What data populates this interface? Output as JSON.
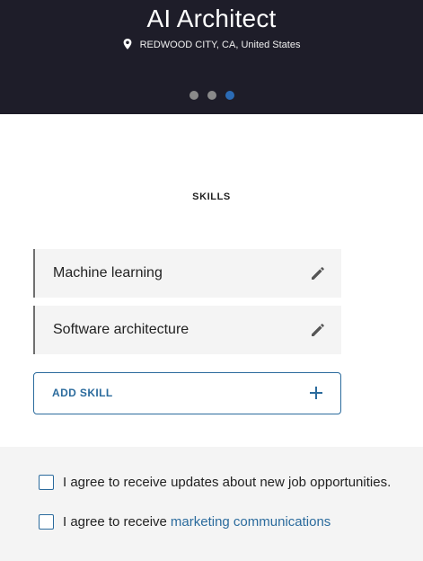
{
  "header": {
    "job_title": "AI Architect",
    "location": "REDWOOD CITY, CA, United States",
    "carousel": {
      "total": 3,
      "active_index": 3
    }
  },
  "skills": {
    "heading": "SKILLS",
    "items": [
      {
        "label": "Machine learning"
      },
      {
        "label": "Software architecture"
      }
    ],
    "add_label": "ADD SKILL"
  },
  "consent": {
    "job_updates": "I agree to receive updates about new job opportunities.",
    "marketing_prefix": "I agree to receive",
    "marketing_link": "marketing communications"
  },
  "colors": {
    "header_bg": "#1e1d29",
    "accent": "#2b6b9d",
    "active_dot": "#2b6bb5"
  },
  "icons": {
    "location": "location-pin-icon",
    "edit": "pencil-icon",
    "add": "plus-icon"
  }
}
